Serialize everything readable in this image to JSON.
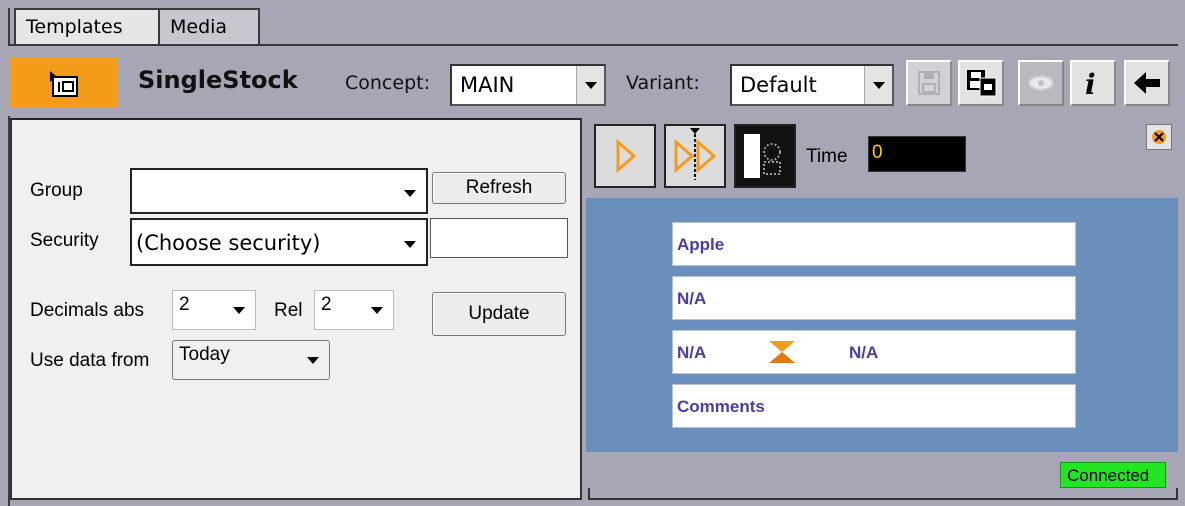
{
  "tabs": [
    {
      "label": "Templates",
      "active": true
    },
    {
      "label": "Media",
      "active": false
    }
  ],
  "toolbar": {
    "template_name": "SingleStock",
    "concept_label": "Concept:",
    "concept_value": "MAIN",
    "variant_label": "Variant:",
    "variant_value": "Default",
    "icons": [
      "save-disabled-icon",
      "save-as-icon",
      "eye-icon",
      "info-icon",
      "back-arrow-icon"
    ]
  },
  "form": {
    "group_label": "Group",
    "group_value": "",
    "refresh_label": "Refresh",
    "security_label": "Security",
    "security_value": "(Choose security)",
    "security_code": "",
    "decimals_abs_label": "Decimals abs",
    "decimals_abs_value": "2",
    "rel_label": "Rel",
    "rel_value": "2",
    "update_label": "Update",
    "use_data_label": "Use data from",
    "use_data_value": "Today"
  },
  "preview": {
    "time_label": "Time",
    "time_value": "0",
    "cards": {
      "name": "Apple",
      "line2": "N/A",
      "line3_left": "N/A",
      "line3_right": "N/A",
      "comments": "Comments"
    },
    "status": "Connected"
  },
  "colors": {
    "accent_orange": "#f59b1a",
    "preview_blue": "#6b8fbd",
    "card_text": "#4c3ea0",
    "status_green": "#22e622",
    "time_text": "#ffcc00"
  }
}
